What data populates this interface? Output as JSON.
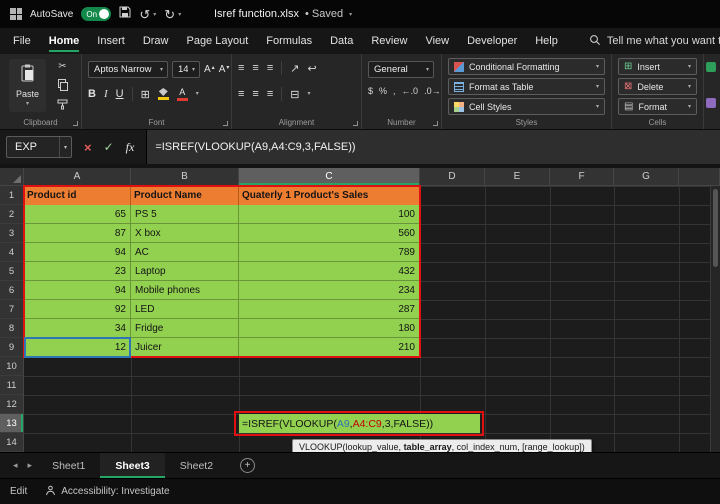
{
  "titlebar": {
    "autosave_label": "AutoSave",
    "autosave_state": "On",
    "filename": "Isref function.xlsx",
    "save_status": "• Saved"
  },
  "menubar": {
    "tabs": [
      "File",
      "Home",
      "Insert",
      "Draw",
      "Page Layout",
      "Formulas",
      "Data",
      "Review",
      "View",
      "Developer",
      "Help"
    ],
    "active_tab": "Home",
    "search_label": "Tell me what you want to do"
  },
  "ribbon": {
    "paste_label": "Paste",
    "font_name": "Aptos Narrow",
    "font_size": "14",
    "bold_label": "B",
    "italic_label": "I",
    "underline_label": "U",
    "number_format": "General",
    "style_buttons": [
      "Conditional Formatting",
      "Format as Table",
      "Cell Styles"
    ],
    "cell_buttons": [
      "Insert",
      "Delete",
      "Format"
    ],
    "group_labels": [
      "Clipboard",
      "Font",
      "Alignment",
      "Number",
      "Styles",
      "Cells"
    ]
  },
  "formula_bar": {
    "name_box": "EXP",
    "fx_label": "fx",
    "formula": "=ISREF(VLOOKUP(A9,A4:C9,3,FALSE))"
  },
  "grid": {
    "col_headers": [
      "A",
      "B",
      "C",
      "D",
      "E",
      "F",
      "G"
    ],
    "row_headers": [
      "1",
      "2",
      "3",
      "4",
      "5",
      "6",
      "7",
      "8",
      "9",
      "10",
      "11",
      "12",
      "13",
      "14"
    ],
    "table": {
      "header": [
        "Product id",
        "Product Name",
        "Quaterly 1 Product's Sales"
      ],
      "rows": [
        [
          "65",
          "PS 5",
          "100"
        ],
        [
          "87",
          "X box",
          "560"
        ],
        [
          "94",
          "AC",
          "789"
        ],
        [
          "23",
          "Laptop",
          "432"
        ],
        [
          "94",
          "Mobile phones",
          "234"
        ],
        [
          "92",
          "LED",
          "287"
        ],
        [
          "34",
          "Fridge",
          "180"
        ],
        [
          "12",
          "Juicer",
          "210"
        ]
      ]
    },
    "formula_cell": {
      "prefix": "=ISREF(VLOOKUP(",
      "ref1": "A9",
      "sep": ",",
      "ref2": "A4:C9",
      "tail": ",3,FALSE",
      "close": "))"
    },
    "tooltip": {
      "pre": "VLOOKUP(lookup_value, ",
      "bold": "table_array",
      "post": ", col_index_num, [range_lookup])"
    }
  },
  "sheet_bar": {
    "tabs": [
      "Sheet1",
      "Sheet3",
      "Sheet2"
    ],
    "active_tab": "Sheet3"
  },
  "status_bar": {
    "mode": "Edit",
    "accessibility": "Accessibility: Investigate"
  },
  "icons": {
    "caret_down": "▾",
    "caret_up": "▴",
    "undo": "↺",
    "redo": "↻",
    "cut": "✂",
    "align_lines": "≡",
    "orientation": "↗",
    "wrap_text": "↩",
    "merge_center": "⊟",
    "borders": "⊞",
    "letter_a": "A",
    "accounting": "$",
    "percent": "%",
    "comma": ",",
    "increase_decimal": "←.0",
    "decrease_decimal": ".0→",
    "insert": "⊞",
    "delete": "⊠",
    "format": "▤",
    "nav_left": "◂",
    "nav_right": "▸",
    "add_sheet": "+",
    "cancel": "×",
    "enter": "✓"
  },
  "colors": {
    "accent_green": "#27A567",
    "table_header_fill": "#ED7D31",
    "table_data_fill": "#92D050",
    "annotation_red": "#E01010",
    "reference_blue": "#2E75B6",
    "reference_red": "#C00000"
  }
}
